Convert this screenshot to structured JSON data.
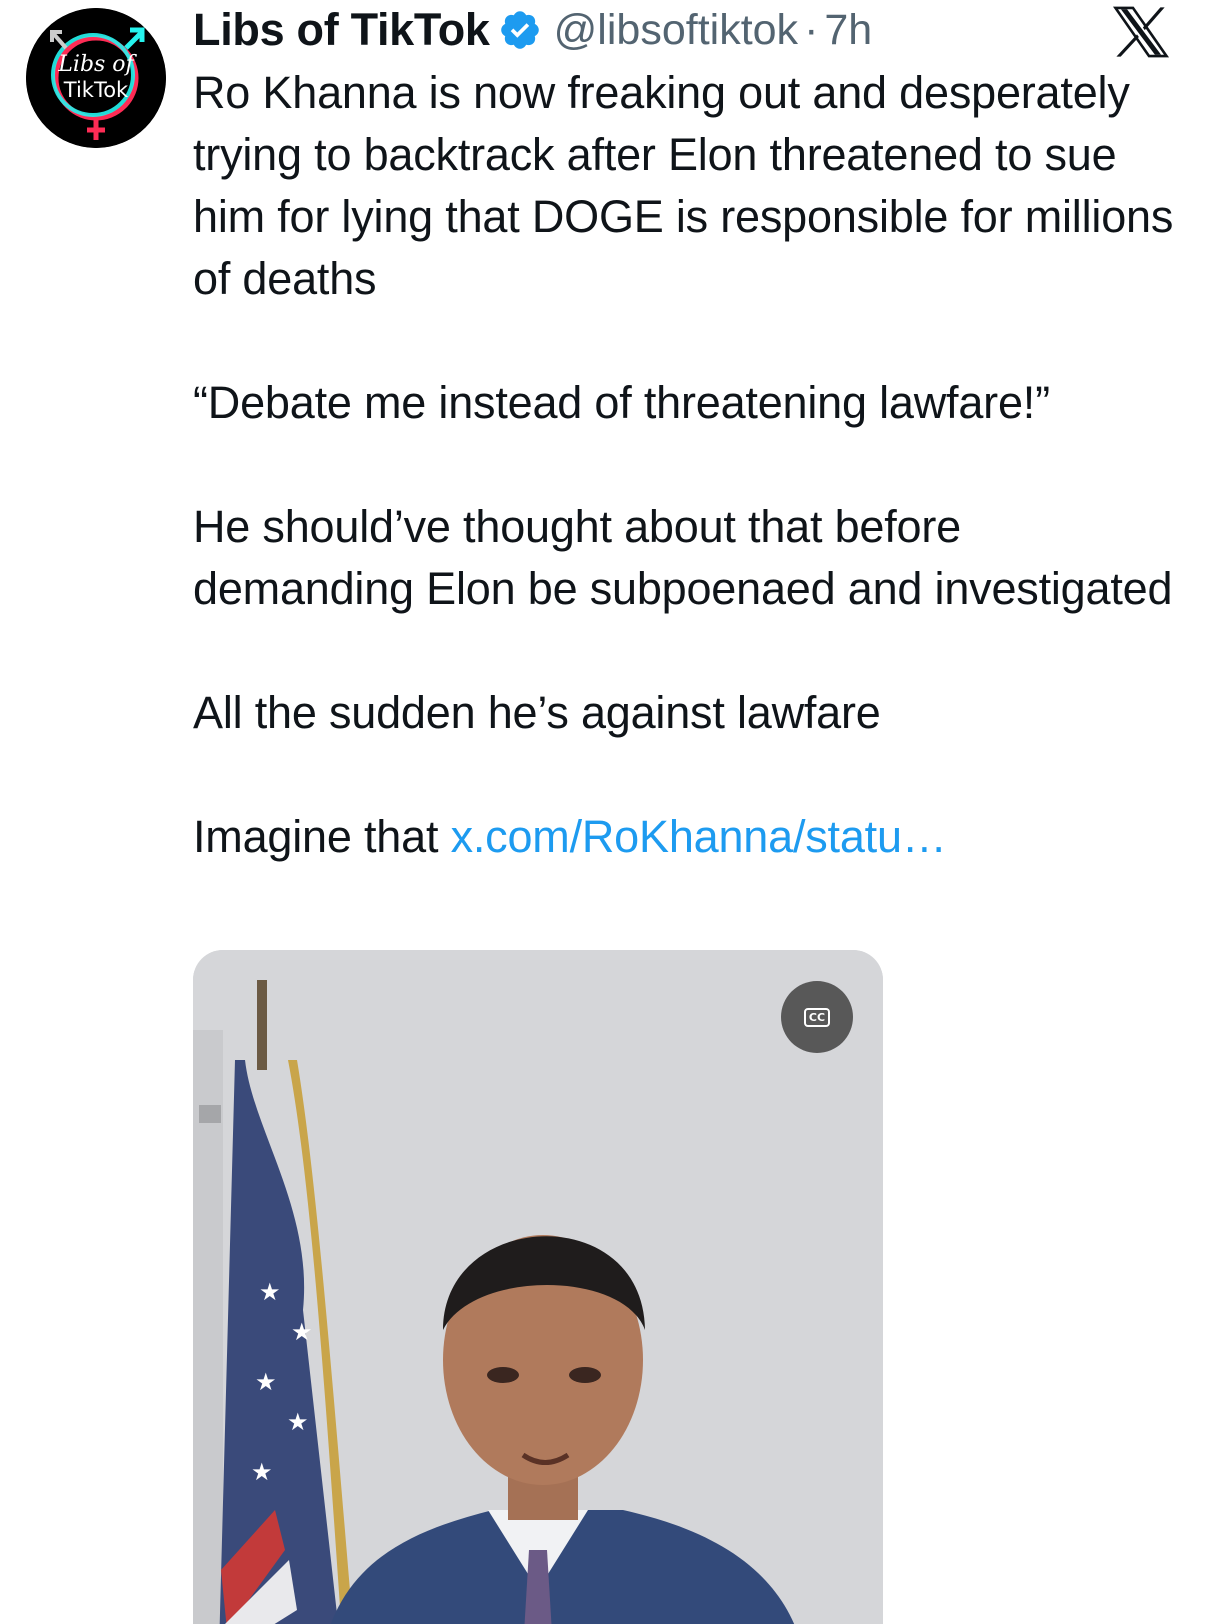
{
  "author": {
    "display_name": "Libs of TikTok",
    "handle": "@libsoftiktok",
    "separator": "·",
    "time": "7h",
    "verified": true,
    "avatar_text_line1": "Libs of",
    "avatar_text_line2": "TikTok"
  },
  "post": {
    "lines": [
      "Ro Khanna is now freaking out and desperately trying to backtrack after Elon threatened to sue him for lying that DOGE is responsible for millions of deaths",
      "“Debate me instead of threatening lawfare!”",
      "He should’ve thought about that before demanding Elon be subpoenaed and investigated",
      "All the sudden he’s against lawfare"
    ],
    "last_line_prefix": "Imagine that ",
    "link_text": "x.com/RoKhanna/statu…"
  },
  "media": {
    "type": "video",
    "cc_label": "CC"
  },
  "icons": {
    "verified": "verified-badge-icon",
    "brand": "x-logo-icon",
    "captions": "closed-captions-icon"
  },
  "colors": {
    "text": "#0f1419",
    "secondary": "#536471",
    "link": "#1d9bf0",
    "verified": "#1d9bf0"
  }
}
